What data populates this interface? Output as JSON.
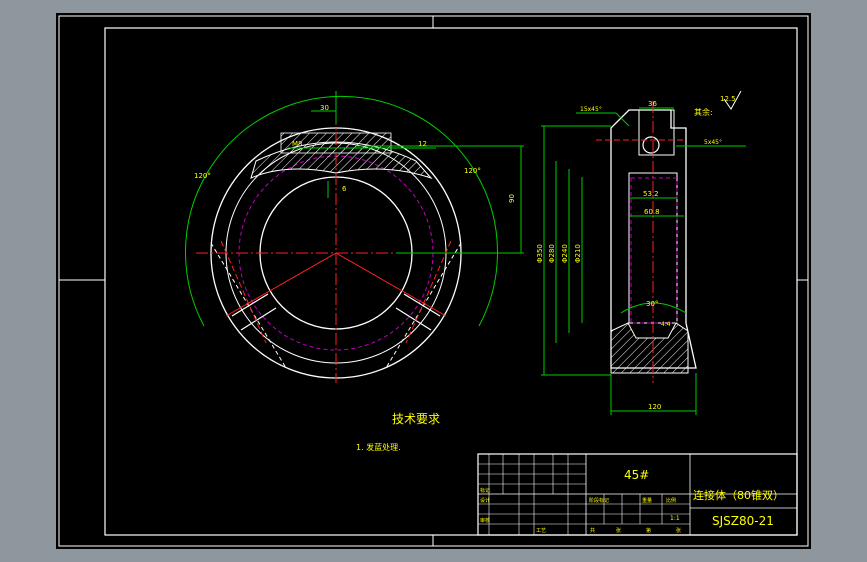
{
  "colors": {
    "background": "#8e969e",
    "sheet": "#000000",
    "frame": "#ffffff",
    "dimension": "#00cc00",
    "centerline": "#ff2020",
    "hidden": "#c000c0",
    "geometry": "#ffffff",
    "text": "#ffff00"
  },
  "title_block": {
    "material": "45#",
    "part_name": "连接体（80锥双）",
    "drawing_no": "SJSZ80-21",
    "scale": "1:1",
    "cells": {
      "r1": "标记",
      "r2": "设计",
      "r3": "审核",
      "r4": "工艺",
      "c1": "阶段标记",
      "c2": "重量",
      "c3": "比例",
      "c4": "共",
      "c5": "张",
      "c6": "第",
      "c7": "张"
    }
  },
  "notes": {
    "heading": "技术要求",
    "item1": "1. 发蓝处理."
  },
  "roughness": {
    "label": "其余:",
    "value": "12.5"
  },
  "front_view": {
    "dim_30": "30",
    "dim_12": "12",
    "dim_m8": "M8",
    "dim_6": "6",
    "dim_120_left": "120°",
    "dim_120_right": "120°",
    "dim_90": "90"
  },
  "side_view": {
    "dim_36": "36",
    "chamfer_top": "15x45°",
    "chamfer_right": "5x45°",
    "dim_53": "53.2",
    "dim_60": "60.8",
    "dia_350": "Φ350",
    "dia_280": "Φ280",
    "dia_240": "Φ240",
    "dia_210": "Φ210",
    "dim_30deg": "30°",
    "dim_4": "4.4",
    "dim_120": "120"
  }
}
